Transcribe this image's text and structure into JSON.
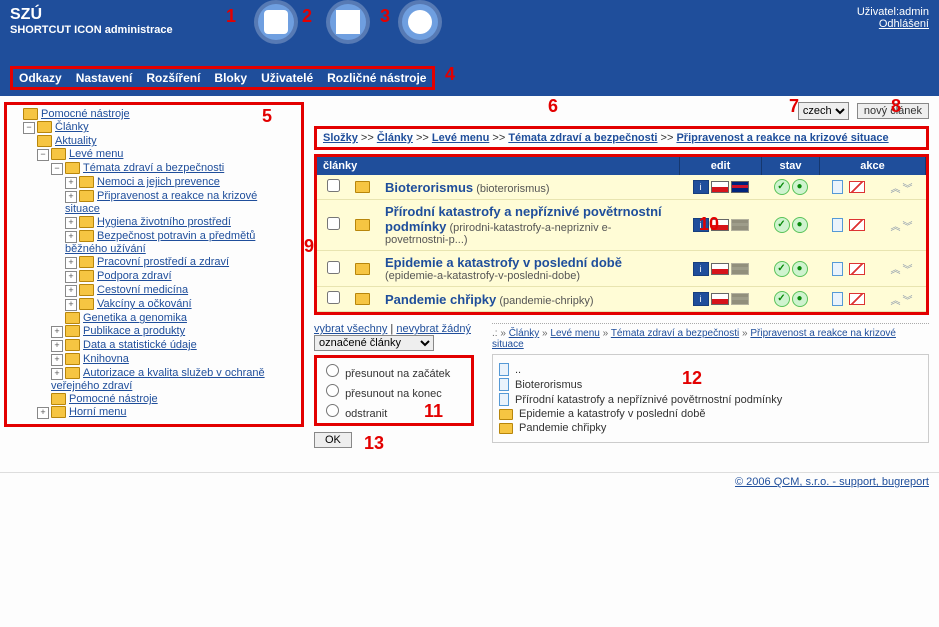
{
  "header": {
    "brand_title": "SZÚ",
    "brand_sub": "SHORTCUT ICON administrace",
    "user_label": "Uživatel:",
    "user_name": "admin",
    "logout": "Odhlášení"
  },
  "toolbar_icons": [
    "document-icon",
    "stats-icon",
    "users-icon"
  ],
  "menu": [
    "Odkazy",
    "Nastavení",
    "Rozšíření",
    "Bloky",
    "Uživatelé",
    "Rozličné nástroje"
  ],
  "tree": {
    "root1": "Pomocné nástroje",
    "root2": "Články",
    "aktuality": "Aktuality",
    "leve_menu": "Levé menu",
    "tema": "Témata zdraví a bezpečnosti",
    "nemoci": "Nemoci a jejich prevence",
    "pripravenost": "Připravenost a reakce na krizové situace",
    "hygiena": "Hygiena životního prostředí",
    "bezp_potr": "Bezpečnost potravin a předmětů běžného užívání",
    "pracovni": "Pracovní prostředí a zdraví",
    "podpora": "Podpora zdraví",
    "cestovni": "Cestovní medicína",
    "vakciny": "Vakcíny a očkování",
    "genetika": "Genetika a genomika",
    "publikace": "Publikace a produkty",
    "data_stat": "Data a statistické údaje",
    "knihovna": "Knihovna",
    "autorizace": "Autorizace a kvalita služeb v ochraně veřejného zdraví",
    "pn2": "Pomocné nástroje",
    "horni": "Horní menu"
  },
  "lang_selected": "czech",
  "new_article": "nový článek",
  "breadcrumb": [
    "Složky",
    "Články",
    "Levé menu",
    "Témata zdraví a bezpečnosti",
    "Připravenost a reakce na krizové situace"
  ],
  "table_head": {
    "c1": "články",
    "c_edit": "edit",
    "c_stav": "stav",
    "c_akce": "akce"
  },
  "articles": [
    {
      "title": "Bioterorismus",
      "slug": "(bioterorismus)",
      "en_muted": false
    },
    {
      "title": "Přírodní katastrofy a nepříznivé povětrnostní podmínky",
      "slug": "(prirodni-katastrofy-a-neprizniv e-povetrnostni-p...)",
      "en_muted": true
    },
    {
      "title": "Epidemie a katastrofy v poslední době",
      "slug": "(epidemie-a-katastrofy-v-posledni-dobe)",
      "en_muted": true
    },
    {
      "title": "Pandemie chřipky",
      "slug": "(pandemie-chripky)",
      "en_muted": true
    }
  ],
  "bulk": {
    "select_all": "vybrat všechny",
    "select_none": "nevybrat žádný",
    "mode": "označené články",
    "opt1": "přesunout na začátek",
    "opt2": "přesunout na konec",
    "opt3": "odstranit",
    "ok": "OK"
  },
  "preview": {
    "crumb_prefix": ".: »",
    "crumb": [
      "Články",
      "Levé menu",
      "Témata zdraví a bezpečnosti",
      "Připravenost a reakce na krizové situace"
    ],
    "up": "..",
    "items": [
      {
        "kind": "page",
        "label": "Bioterorismus"
      },
      {
        "kind": "page",
        "label": "Přírodní katastrofy a nepříznivé povětrnostní podmínky"
      },
      {
        "kind": "folder",
        "label": "Epidemie a katastrofy v poslední době"
      },
      {
        "kind": "folder",
        "label": "Pandemie chřipky"
      }
    ]
  },
  "footer": "© 2006 QCM, s.r.o. - support, bugreport",
  "annotations": {
    "1": "1",
    "2": "2",
    "3": "3",
    "4": "4",
    "5": "5",
    "6": "6",
    "7": "7",
    "8": "8",
    "9": "9",
    "10": "10",
    "11": "11",
    "12": "12",
    "13": "13"
  }
}
